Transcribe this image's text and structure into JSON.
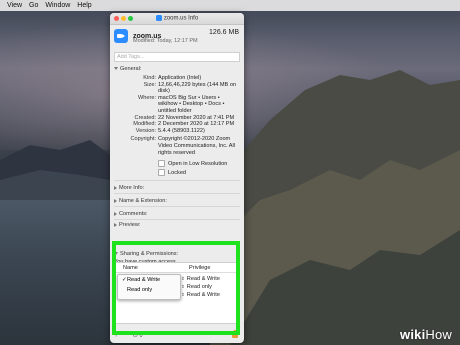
{
  "menubar": [
    "View",
    "Go",
    "Window",
    "Help"
  ],
  "window": {
    "title": "zoom.us Info",
    "traffic_colors": [
      "#ff5f57",
      "#febc2e",
      "#28c840"
    ],
    "app_name": "zoom.us",
    "app_size": "126.6 MB",
    "modified_header": "Modified: Today, 12:17 PM",
    "tags_placeholder": "Add Tags...",
    "general_label": "General:",
    "general": [
      {
        "k": "Kind:",
        "v": "Application (Intel)"
      },
      {
        "k": "Size:",
        "v": "12,66,46,229 bytes (144 MB on disk)"
      },
      {
        "k": "Where:",
        "v": "macOS Big Sur • Users • wikihow • Desktop • Docs • untitled folder"
      },
      {
        "k": "Created:",
        "v": "22 November 2020 at 7:41 PM"
      },
      {
        "k": "Modified:",
        "v": "2 December 2020 at 12:17 PM"
      },
      {
        "k": "Version:",
        "v": "5.4.4 (58903.1122)"
      },
      {
        "k": "Copyright:",
        "v": "Copyright ©2012-2020 Zoom Video Communications, Inc. All rights reserved"
      }
    ],
    "checkbox_low_res": "Open in Low Resolution",
    "checkbox_locked": "Locked",
    "collapsed_sections": [
      "More Info:",
      "Name & Extension:",
      "Comments:",
      "Preview:"
    ],
    "sharing_label": "Sharing & Permissions:",
    "custom_access": "You have custom access",
    "col_name": "Name",
    "col_privilege": "Privilege",
    "privileges": [
      "Read & Write",
      "Read only",
      "Read & Write"
    ],
    "popup_options": [
      {
        "label": "Read & Write",
        "checked": true
      },
      {
        "label": "Read only",
        "checked": false
      }
    ],
    "footer": {
      "add": "+",
      "remove": "−",
      "gear": "⊙",
      "chevron": "⌄"
    }
  },
  "highlight_color": "#1fe21f",
  "watermark": {
    "wiki": "wiki",
    "how": "How"
  }
}
